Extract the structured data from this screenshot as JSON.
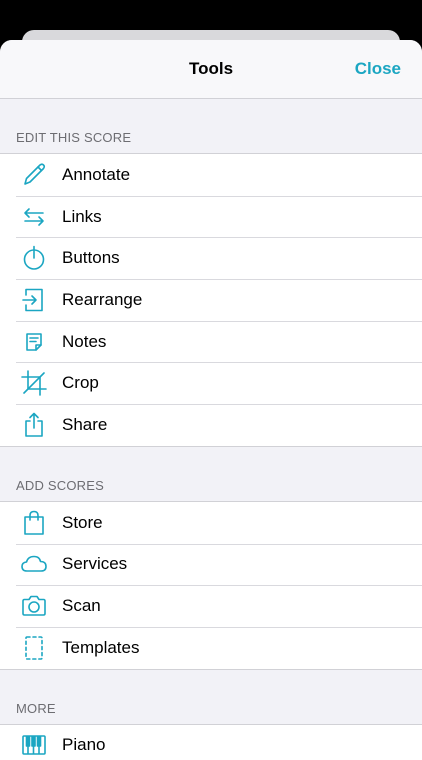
{
  "header": {
    "title": "Tools",
    "close_label": "Close"
  },
  "sections": [
    {
      "title": "EDIT THIS SCORE",
      "items": [
        {
          "label": "Annotate",
          "icon": "pencil-icon"
        },
        {
          "label": "Links",
          "icon": "arrows-icon"
        },
        {
          "label": "Buttons",
          "icon": "tap-icon"
        },
        {
          "label": "Rearrange",
          "icon": "rearrange-icon"
        },
        {
          "label": "Notes",
          "icon": "note-icon"
        },
        {
          "label": "Crop",
          "icon": "crop-icon"
        },
        {
          "label": "Share",
          "icon": "share-icon"
        }
      ]
    },
    {
      "title": "ADD SCORES",
      "items": [
        {
          "label": "Store",
          "icon": "bag-icon"
        },
        {
          "label": "Services",
          "icon": "cloud-icon"
        },
        {
          "label": "Scan",
          "icon": "camera-icon"
        },
        {
          "label": "Templates",
          "icon": "template-icon"
        }
      ]
    },
    {
      "title": "MORE",
      "items": [
        {
          "label": "Piano",
          "icon": "piano-icon"
        }
      ]
    }
  ],
  "colors": {
    "accent": "#1ba6c2"
  }
}
